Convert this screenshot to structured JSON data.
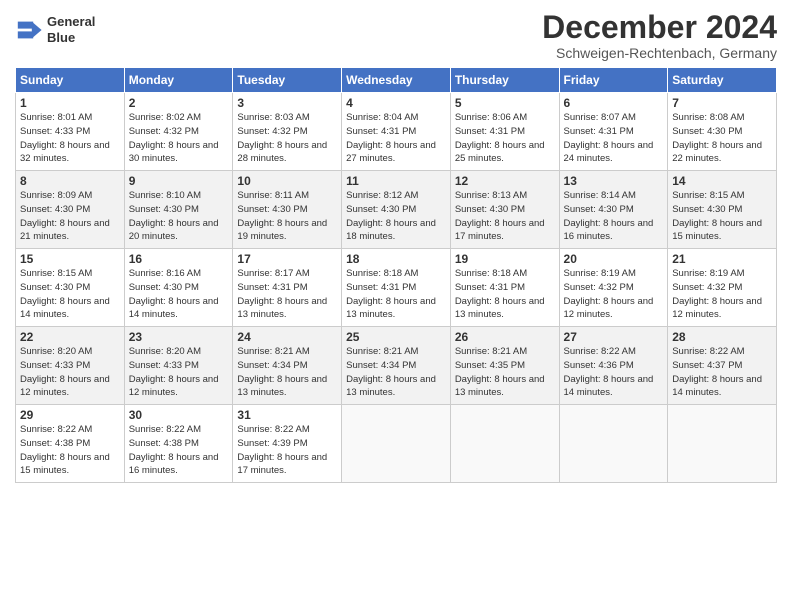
{
  "header": {
    "logo_line1": "General",
    "logo_line2": "Blue",
    "month": "December 2024",
    "location": "Schweigen-Rechtenbach, Germany"
  },
  "days_of_week": [
    "Sunday",
    "Monday",
    "Tuesday",
    "Wednesday",
    "Thursday",
    "Friday",
    "Saturday"
  ],
  "weeks": [
    [
      {
        "day": 1,
        "sunrise": "8:01 AM",
        "sunset": "4:33 PM",
        "daylight": "8 hours and 32 minutes."
      },
      {
        "day": 2,
        "sunrise": "8:02 AM",
        "sunset": "4:32 PM",
        "daylight": "8 hours and 30 minutes."
      },
      {
        "day": 3,
        "sunrise": "8:03 AM",
        "sunset": "4:32 PM",
        "daylight": "8 hours and 28 minutes."
      },
      {
        "day": 4,
        "sunrise": "8:04 AM",
        "sunset": "4:31 PM",
        "daylight": "8 hours and 27 minutes."
      },
      {
        "day": 5,
        "sunrise": "8:06 AM",
        "sunset": "4:31 PM",
        "daylight": "8 hours and 25 minutes."
      },
      {
        "day": 6,
        "sunrise": "8:07 AM",
        "sunset": "4:31 PM",
        "daylight": "8 hours and 24 minutes."
      },
      {
        "day": 7,
        "sunrise": "8:08 AM",
        "sunset": "4:30 PM",
        "daylight": "8 hours and 22 minutes."
      }
    ],
    [
      {
        "day": 8,
        "sunrise": "8:09 AM",
        "sunset": "4:30 PM",
        "daylight": "8 hours and 21 minutes."
      },
      {
        "day": 9,
        "sunrise": "8:10 AM",
        "sunset": "4:30 PM",
        "daylight": "8 hours and 20 minutes."
      },
      {
        "day": 10,
        "sunrise": "8:11 AM",
        "sunset": "4:30 PM",
        "daylight": "8 hours and 19 minutes."
      },
      {
        "day": 11,
        "sunrise": "8:12 AM",
        "sunset": "4:30 PM",
        "daylight": "8 hours and 18 minutes."
      },
      {
        "day": 12,
        "sunrise": "8:13 AM",
        "sunset": "4:30 PM",
        "daylight": "8 hours and 17 minutes."
      },
      {
        "day": 13,
        "sunrise": "8:14 AM",
        "sunset": "4:30 PM",
        "daylight": "8 hours and 16 minutes."
      },
      {
        "day": 14,
        "sunrise": "8:15 AM",
        "sunset": "4:30 PM",
        "daylight": "8 hours and 15 minutes."
      }
    ],
    [
      {
        "day": 15,
        "sunrise": "8:15 AM",
        "sunset": "4:30 PM",
        "daylight": "8 hours and 14 minutes."
      },
      {
        "day": 16,
        "sunrise": "8:16 AM",
        "sunset": "4:30 PM",
        "daylight": "8 hours and 14 minutes."
      },
      {
        "day": 17,
        "sunrise": "8:17 AM",
        "sunset": "4:31 PM",
        "daylight": "8 hours and 13 minutes."
      },
      {
        "day": 18,
        "sunrise": "8:18 AM",
        "sunset": "4:31 PM",
        "daylight": "8 hours and 13 minutes."
      },
      {
        "day": 19,
        "sunrise": "8:18 AM",
        "sunset": "4:31 PM",
        "daylight": "8 hours and 13 minutes."
      },
      {
        "day": 20,
        "sunrise": "8:19 AM",
        "sunset": "4:32 PM",
        "daylight": "8 hours and 12 minutes."
      },
      {
        "day": 21,
        "sunrise": "8:19 AM",
        "sunset": "4:32 PM",
        "daylight": "8 hours and 12 minutes."
      }
    ],
    [
      {
        "day": 22,
        "sunrise": "8:20 AM",
        "sunset": "4:33 PM",
        "daylight": "8 hours and 12 minutes."
      },
      {
        "day": 23,
        "sunrise": "8:20 AM",
        "sunset": "4:33 PM",
        "daylight": "8 hours and 12 minutes."
      },
      {
        "day": 24,
        "sunrise": "8:21 AM",
        "sunset": "4:34 PM",
        "daylight": "8 hours and 13 minutes."
      },
      {
        "day": 25,
        "sunrise": "8:21 AM",
        "sunset": "4:34 PM",
        "daylight": "8 hours and 13 minutes."
      },
      {
        "day": 26,
        "sunrise": "8:21 AM",
        "sunset": "4:35 PM",
        "daylight": "8 hours and 13 minutes."
      },
      {
        "day": 27,
        "sunrise": "8:22 AM",
        "sunset": "4:36 PM",
        "daylight": "8 hours and 14 minutes."
      },
      {
        "day": 28,
        "sunrise": "8:22 AM",
        "sunset": "4:37 PM",
        "daylight": "8 hours and 14 minutes."
      }
    ],
    [
      {
        "day": 29,
        "sunrise": "8:22 AM",
        "sunset": "4:38 PM",
        "daylight": "8 hours and 15 minutes."
      },
      {
        "day": 30,
        "sunrise": "8:22 AM",
        "sunset": "4:38 PM",
        "daylight": "8 hours and 16 minutes."
      },
      {
        "day": 31,
        "sunrise": "8:22 AM",
        "sunset": "4:39 PM",
        "daylight": "8 hours and 17 minutes."
      },
      null,
      null,
      null,
      null
    ]
  ]
}
